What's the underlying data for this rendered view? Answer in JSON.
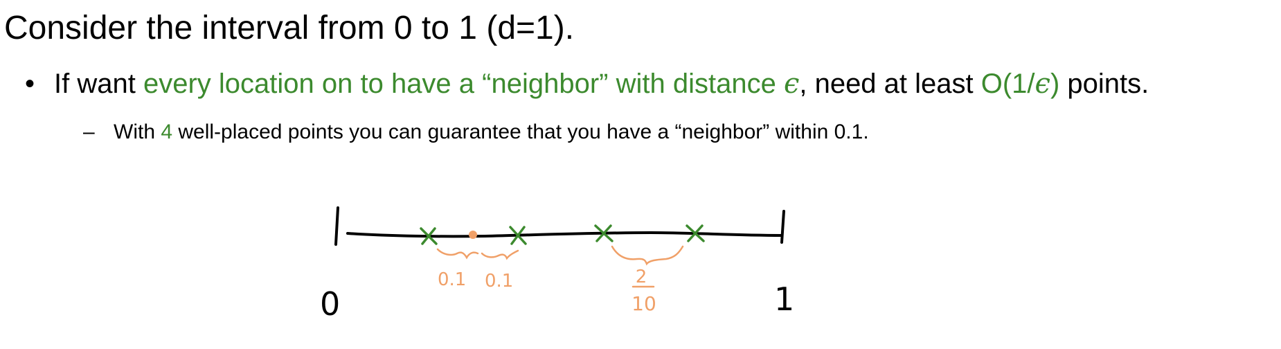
{
  "title": "Consider the interval from 0 to 1 (d=1).",
  "bullet": {
    "marker": "•",
    "prefix": "If want ",
    "highlight": "every location on to have a “neighbor” with distance ",
    "highlight_symbol": "ϵ",
    "middle": ", need at least ",
    "bound": "O(1/",
    "bound_symbol": "ϵ",
    "bound_close": ")",
    "suffix": " points."
  },
  "sub_bullet": {
    "marker": "–",
    "prefix": "With ",
    "count": "4",
    "suffix": " well-placed points you can guarantee that you have a “neighbor” within 0.1."
  },
  "sketch": {
    "label_start": "0",
    "label_end": "1",
    "gap_label_1": "0.1",
    "gap_label_2": "0.1",
    "fraction_numerator": "2",
    "fraction_denominator": "10",
    "point_marker": "×",
    "colors": {
      "green": "#3c8a2e",
      "orange": "#f0a068",
      "ink": "#000000"
    }
  }
}
